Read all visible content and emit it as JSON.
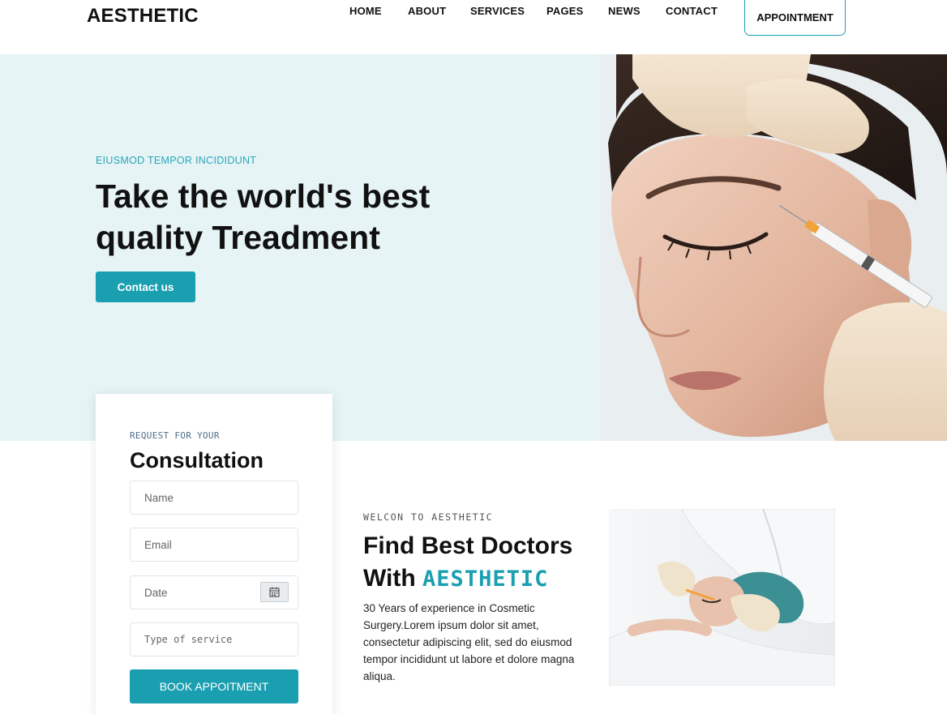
{
  "header": {
    "logo": "AESTHETIC",
    "nav": [
      "HOME",
      "ABOUT",
      "SERVICES",
      "PAGES",
      "NEWS",
      "CONTACT"
    ],
    "appointment_label": "APPOINTMENT"
  },
  "hero": {
    "eyebrow": "EIUSMOD TEMPOR INCIDIDUNT",
    "title": "Take the world's best quality Treadment",
    "cta_label": "Contact us"
  },
  "consultation": {
    "eyebrow": "REQUEST FOR YOUR",
    "title": "Consultation",
    "name_placeholder": "Name",
    "email_placeholder": "Email",
    "date_placeholder": "Date",
    "service_placeholder": "Type of service",
    "submit_label": "BOOK APPOITMENT"
  },
  "about": {
    "eyebrow": "WELCON TO AESTHETIC",
    "title_line1": "Find Best Doctors",
    "title_line2_prefix": "With",
    "title_brand": "AESTHETIC",
    "text": "30 Years of experience in Cosmetic Surgery.Lorem ipsum dolor sit amet, consectetur adipiscing elit, sed do eiusmod tempor incididunt ut labore et dolore magna aliqua."
  },
  "colors": {
    "accent": "#1a9fb1",
    "hero_bg": "#e6f4f6",
    "text_dark": "#111111"
  },
  "icons": {
    "calendar": "calendar-icon"
  }
}
